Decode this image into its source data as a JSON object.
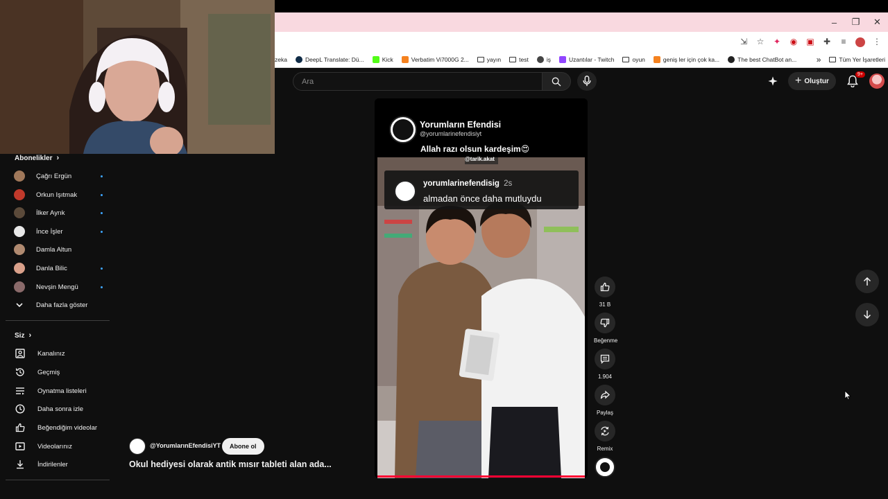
{
  "browser": {
    "window_controls": [
      "–",
      "❐",
      "✕"
    ],
    "bookmarks": [
      {
        "label": "zeka",
        "icon": "none"
      },
      {
        "label": "DeepL Translate: Dü...",
        "icon": "deepl-icon",
        "color": "#0f2b46"
      },
      {
        "label": "Kick",
        "icon": "kick-icon",
        "color": "#53fc18"
      },
      {
        "label": "Verbatim Vi7000G 2...",
        "icon": "store-icon",
        "color": "#f58220"
      },
      {
        "label": "yayın",
        "icon": "folder-icon"
      },
      {
        "label": "test",
        "icon": "folder-icon"
      },
      {
        "label": "iş",
        "icon": "globe-icon"
      },
      {
        "label": "Uzantılar - Twitch",
        "icon": "twitch-icon",
        "color": "#9146ff"
      },
      {
        "label": "oyun",
        "icon": "folder-icon"
      },
      {
        "label": "geniş ler için çok ka...",
        "icon": "store-icon",
        "color": "#f58220"
      },
      {
        "label": "The best ChatBot an...",
        "icon": "chatbot-icon",
        "color": "#222222"
      }
    ],
    "bookmarks_overflow": "»",
    "all_bookmarks": "Tüm Yer İşaretleri"
  },
  "header": {
    "search_placeholder": "Ara",
    "create_label": "Oluştur",
    "notif_count": "9+"
  },
  "sidebar": {
    "subscriptions_title": "Abonelikler",
    "subscriptions": [
      {
        "name": "Çağrı Ergün",
        "color": "#a0785a",
        "dot": true
      },
      {
        "name": "Orkun Işıtmak",
        "color": "#c0392b",
        "dot": true
      },
      {
        "name": "İlker Ayrık",
        "color": "#5b4a3a",
        "dot": true
      },
      {
        "name": "İnce İşler",
        "color": "#e8e8e8",
        "dot": true
      },
      {
        "name": "Damla Altun",
        "color": "#b08a70",
        "dot": false
      },
      {
        "name": "Danla Bilic",
        "color": "#d9a08a",
        "dot": true
      },
      {
        "name": "Nevşin Mengü",
        "color": "#8a6a6a",
        "dot": true
      }
    ],
    "show_more": "Daha fazla göster",
    "you_title": "Siz",
    "you_items": [
      {
        "label": "Kanalınız",
        "icon": "account-icon"
      },
      {
        "label": "Geçmiş",
        "icon": "history-icon"
      },
      {
        "label": "Oynatma listeleri",
        "icon": "playlist-icon"
      },
      {
        "label": "Daha sonra izle",
        "icon": "clock-icon"
      },
      {
        "label": "Beğendiğim videolar",
        "icon": "like-icon"
      },
      {
        "label": "Videolarınız",
        "icon": "video-icon"
      },
      {
        "label": "İndirilenler",
        "icon": "download-icon"
      }
    ]
  },
  "video": {
    "overlay_channel_name": "Yorumların Efendisi",
    "overlay_channel_handle": "@yorumlarinefendisiyt",
    "overlay_caption": "Allah razı olsun kardeşim😍",
    "tiktok_handle": "@tarik.akat",
    "comment_user": "yorumlarinefendisig",
    "comment_time": "2s",
    "comment_text": "almadan önce daha mutluydu",
    "logo_text": "YORUMLARIN EFENDİSİ"
  },
  "actions": {
    "likes": "31 B",
    "dislike_label": "Beğenme",
    "comments": "1.904",
    "share_label": "Paylaş",
    "remix_label": "Remix"
  },
  "info": {
    "channel": "@YorumlarınEfendisiYT",
    "subscribe_label": "Abone ol",
    "title": "Okul hediyesi olarak antik mısır tableti alan ada..."
  }
}
